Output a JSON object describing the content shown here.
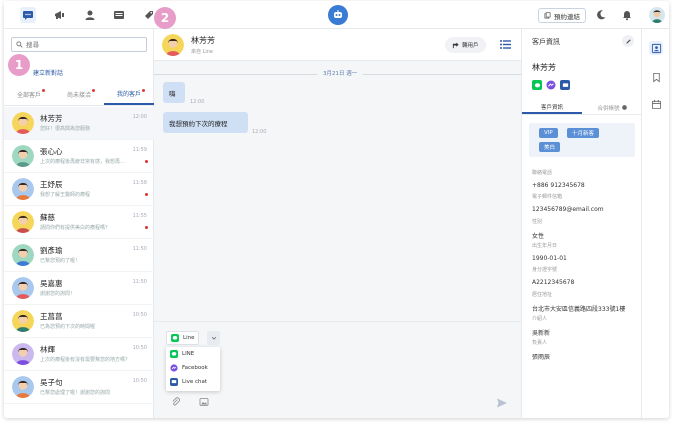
{
  "colors": {
    "accent": "#2b5aa8",
    "bubble": "#cfe0f5",
    "line_green": "#06c755",
    "badge": "#e58cc0",
    "tag_blue": "#5b8fd6"
  },
  "topbar": {
    "icons": [
      "chat-icon",
      "megaphone-icon",
      "user-icon",
      "billboard-icon",
      "tag-icon"
    ],
    "booking_label": "預約連結",
    "icons_right": [
      "moon-icon",
      "bell-icon",
      "avatar"
    ]
  },
  "badges": {
    "one": "1",
    "two": "2"
  },
  "left": {
    "search_placeholder": "搜尋",
    "new_chat_label": "建立新對話",
    "tabs": [
      {
        "label": "全部客戶",
        "dot": true
      },
      {
        "label": "尚未接洽",
        "dot": true
      },
      {
        "label": "我的客戶",
        "dot": true
      }
    ],
    "conversations": [
      {
        "name": "林芳芳",
        "msg": "您好！很高興為您服務",
        "time": "12:00",
        "unread": false
      },
      {
        "name": "張心心",
        "msg": "上次的療程後再疲非常有感，我想再…",
        "time": "11:59",
        "unread": true
      },
      {
        "name": "王妤辰",
        "msg": "我想了解王醫師的療程",
        "time": "11:58",
        "unread": true
      },
      {
        "name": "蘇慈",
        "msg": "請問你們有提供美白的療程嗎？",
        "time": "11:55",
        "unread": true
      },
      {
        "name": "劉彥瑜",
        "msg": "已幫您預約了喔！",
        "time": "11:50",
        "unread": false
      },
      {
        "name": "吳嘉惠",
        "msg": "謝謝您的詢問！",
        "time": "11:50",
        "unread": false
      },
      {
        "name": "王菖菖",
        "msg": "已為您預約下次的時間喔",
        "time": "10:50",
        "unread": false
      },
      {
        "name": "林輝",
        "msg": "上次的療程後有沒有需要幫您的地方嗎？",
        "time": "10:50",
        "unread": false
      },
      {
        "name": "吳子句",
        "msg": "已幫您處理了喔！謝謝您的詢問",
        "time": "10:50",
        "unread": false
      }
    ]
  },
  "chat": {
    "name": "林芳芳",
    "source": "來自 Line",
    "transfer_label": "轉用戶",
    "date_sep": "3月21日 週一",
    "messages": [
      {
        "text": "嗨",
        "time": "12:00"
      },
      {
        "text": "我想預約下次的療程",
        "time": "12:00"
      }
    ],
    "channel_selected": "Line",
    "channel_options": [
      "LINE",
      "Facebook",
      "Live chat"
    ]
  },
  "right": {
    "title": "客戶資訊",
    "name": "林芳芳",
    "tabs": [
      "客戶資訊",
      "合併帳號"
    ],
    "tags": [
      "VIP",
      "十月新客",
      "美白"
    ],
    "fields": [
      {
        "label": "聯絡電話",
        "value": "+886 912345678"
      },
      {
        "label": "電子郵件信箱",
        "value": "123456789@email.com"
      },
      {
        "label": "性別",
        "value": "女性"
      },
      {
        "label": "出生年月日",
        "value": "1990-01-01"
      },
      {
        "label": "身分證字號",
        "value": "A2212345678"
      },
      {
        "label": "居住地址",
        "value": "台北市大安區信義路四段333號1樓"
      },
      {
        "label": "介紹人",
        "value": "吳新新"
      },
      {
        "label": "負責人",
        "value": "張雨辰"
      }
    ]
  },
  "rail": {
    "icons": [
      "contact-card-icon",
      "bookmark-icon",
      "calendar-icon"
    ]
  }
}
